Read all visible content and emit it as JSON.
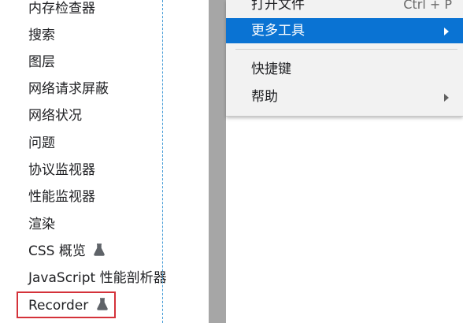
{
  "tools_list": {
    "items": [
      {
        "label": "内存检查器",
        "experimental": false
      },
      {
        "label": "搜索",
        "experimental": false
      },
      {
        "label": "图层",
        "experimental": false
      },
      {
        "label": "网络请求屏蔽",
        "experimental": false
      },
      {
        "label": "网络状况",
        "experimental": false
      },
      {
        "label": "问题",
        "experimental": false
      },
      {
        "label": "协议监视器",
        "experimental": false
      },
      {
        "label": "性能监视器",
        "experimental": false
      },
      {
        "label": "渲染",
        "experimental": false
      },
      {
        "label": "CSS 概览",
        "experimental": true
      },
      {
        "label": "JavaScript 性能剖析器",
        "experimental": false
      },
      {
        "label": "Recorder",
        "experimental": true
      }
    ],
    "highlighted_item": "Recorder",
    "experimental_icon": "flask-icon"
  },
  "context_menu": {
    "items": [
      {
        "label": "打开文件",
        "shortcut": "Ctrl + P",
        "submenu": false,
        "highlighted": false
      },
      {
        "label": "更多工具",
        "shortcut": "",
        "submenu": true,
        "highlighted": true
      },
      {
        "label": "快捷键",
        "shortcut": "",
        "submenu": false,
        "highlighted": false
      },
      {
        "label": "帮助",
        "shortcut": "",
        "submenu": true,
        "highlighted": false
      }
    ],
    "highlight_color": "#0a73d3"
  },
  "colors": {
    "annotation_box": "#d4323a",
    "guide_line": "#4a9fd8",
    "separator_bar": "#a6a6a6"
  }
}
